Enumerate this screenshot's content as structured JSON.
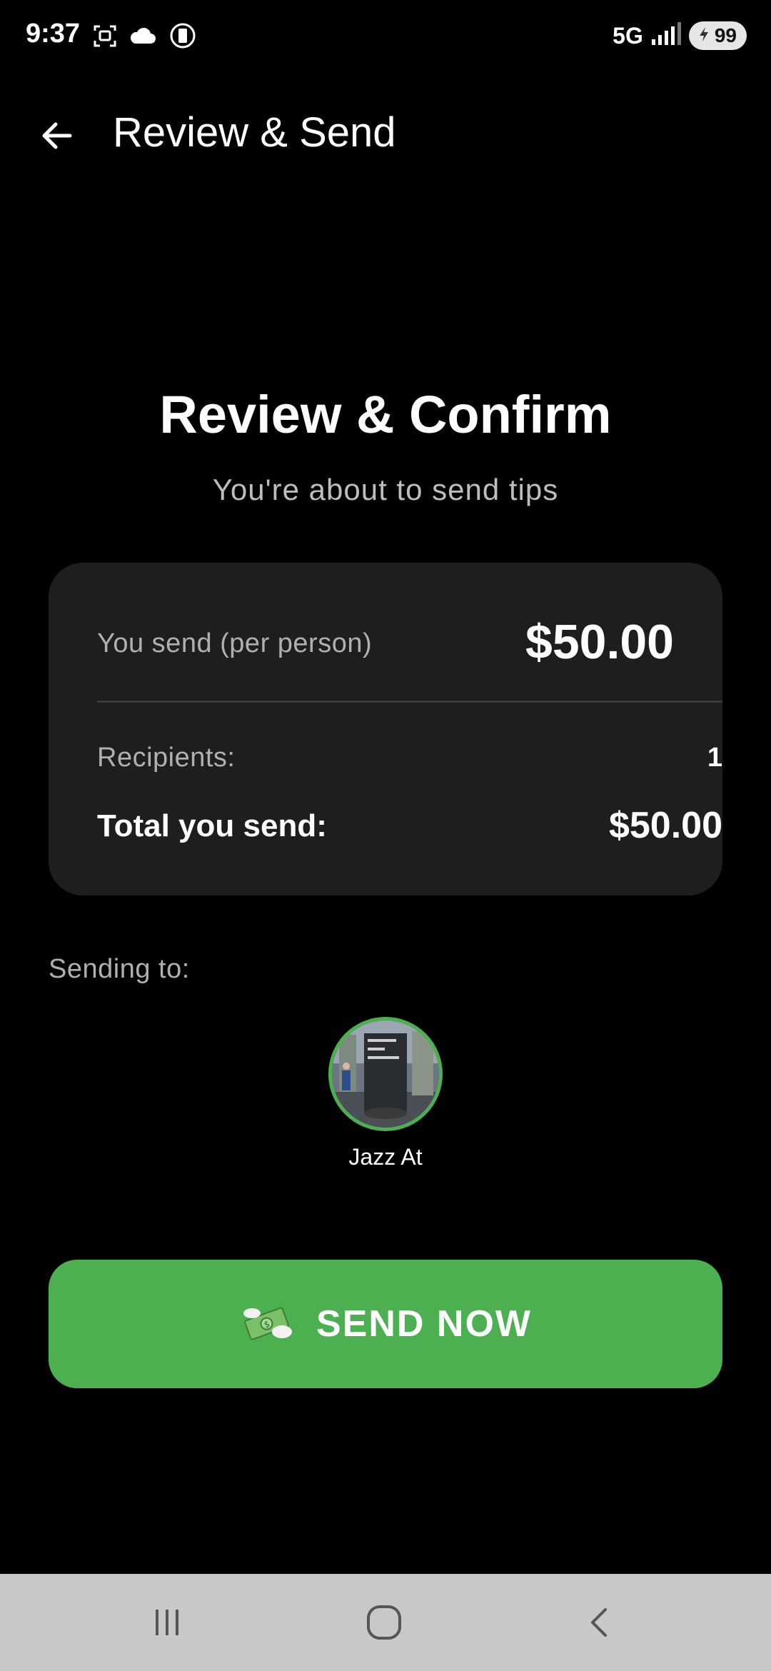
{
  "status_bar": {
    "time": "9:37",
    "network": "5G",
    "battery": "99",
    "icons_left": [
      "screenshot-icon",
      "cloud-icon",
      "sim-icon"
    ],
    "icons_right": [
      "signal-icon",
      "battery-icon"
    ]
  },
  "app_bar": {
    "title": "Review & Send",
    "back_icon": "arrow-left-icon"
  },
  "header": {
    "title": "Review & Confirm",
    "subtitle": "You're about to send tips"
  },
  "summary": {
    "per_person_label": "You send (per person)",
    "per_person_value": "$50.00",
    "recipients_label": "Recipients:",
    "recipients_value": "1",
    "total_label": "Total you send:",
    "total_value": "$50.00"
  },
  "sending_to": {
    "label": "Sending to:",
    "recipients": [
      {
        "name": "Jazz At"
      }
    ]
  },
  "send_button": {
    "label": "SEND NOW",
    "icon": "money-wings-icon"
  },
  "nav_bar": {
    "icons": [
      "recent-apps-icon",
      "home-icon",
      "back-icon"
    ]
  },
  "colors": {
    "background": "#000000",
    "card": "#1e1e1e",
    "accent_green": "#4caf50",
    "muted_text": "#b0b0b0",
    "nav_bar": "#c8c8c8"
  }
}
